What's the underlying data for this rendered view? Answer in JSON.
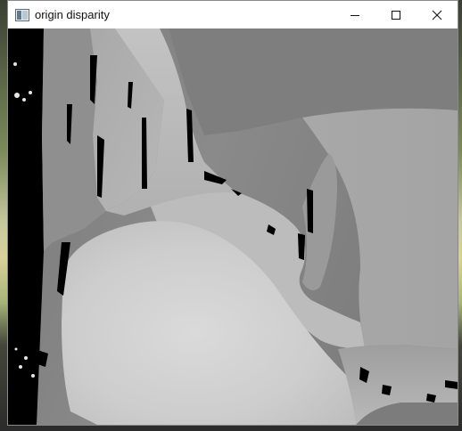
{
  "window": {
    "title": "origin disparity",
    "icons": {
      "app": "app-window-icon",
      "minimize": "minimize-icon",
      "maximize": "maximize-icon",
      "close": "close-icon"
    }
  },
  "colors": {
    "titlebar": "#ffffff",
    "border": "#8a8a8a",
    "disparity_dark": "#000000",
    "disparity_mid": "#8c8c8c",
    "disparity_light": "#d6d6d6"
  }
}
